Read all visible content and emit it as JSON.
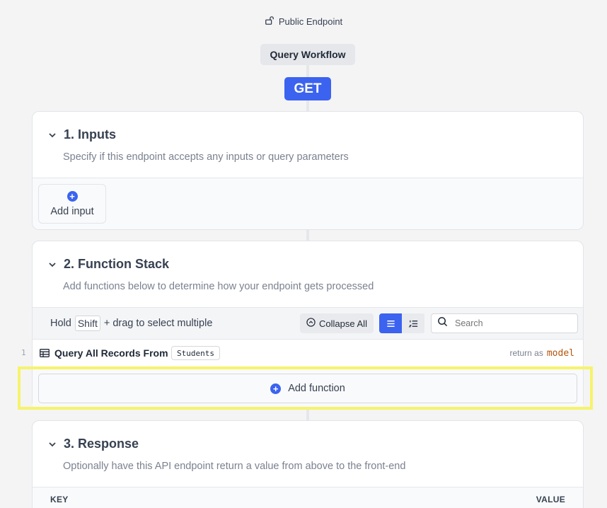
{
  "header": {
    "endpoint_visibility": "Public Endpoint",
    "workflow_name": "Query Workflow",
    "method": "GET"
  },
  "inputs_section": {
    "title": "1. Inputs",
    "subtitle": "Specify if this endpoint accepts any inputs or query parameters",
    "add_label": "Add input"
  },
  "function_stack": {
    "title": "2. Function Stack",
    "subtitle": "Add functions below to determine how your endpoint gets processed",
    "toolbar": {
      "hold_label": "Hold",
      "shift_key": "Shift",
      "drag_hint": "+ drag to select multiple",
      "collapse_label": "Collapse All",
      "search_placeholder": "Search"
    },
    "functions": [
      {
        "index": "1",
        "label": "Query All Records From",
        "table": "Students",
        "return_label": "return as",
        "return_var": "model"
      }
    ],
    "add_label": "Add function"
  },
  "response_section": {
    "title": "3. Response",
    "subtitle": "Optionally have this API endpoint return a value from above to the front-end",
    "columns": {
      "key": "KEY",
      "value": "VALUE"
    }
  },
  "colors": {
    "accent": "#3b63f0",
    "highlight": "#f6f36b",
    "return_var": "#b45309"
  }
}
